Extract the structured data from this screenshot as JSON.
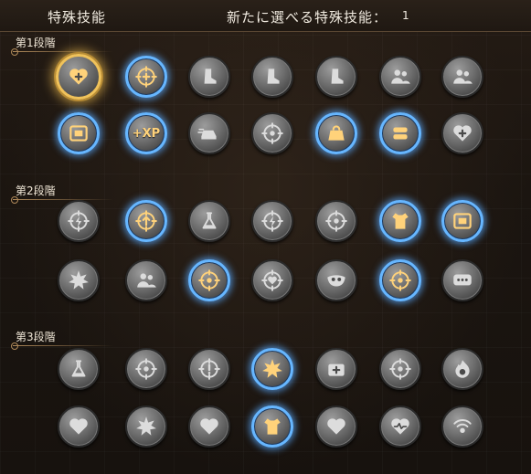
{
  "header": {
    "title": "特殊技能",
    "new_selectable": "新たに選べる特殊技能：",
    "count": "1"
  },
  "stages": [
    {
      "label": "第1段階",
      "rows": [
        [
          {
            "icon": "heart-plus-icon",
            "state": "selected"
          },
          {
            "icon": "crosshair-plus-icon",
            "state": "active"
          },
          {
            "icon": "boot-stripes-icon",
            "state": "inactive"
          },
          {
            "icon": "boot-icon",
            "state": "inactive"
          },
          {
            "icon": "running-shoe-icon",
            "state": "inactive"
          },
          {
            "icon": "team-star-icon",
            "state": "inactive"
          },
          {
            "icon": "squad-alert-icon",
            "state": "inactive"
          }
        ],
        [
          {
            "icon": "ticket-icon",
            "state": "active"
          },
          {
            "icon": "xp-plus-icon",
            "state": "active",
            "text": "+XP"
          },
          {
            "icon": "speed-car-icon",
            "state": "inactive"
          },
          {
            "icon": "target-timer-icon",
            "state": "inactive"
          },
          {
            "icon": "weight-icon",
            "state": "active"
          },
          {
            "icon": "ammo-icon",
            "state": "active"
          },
          {
            "icon": "heart-plus-medkit-icon",
            "state": "inactive"
          }
        ]
      ]
    },
    {
      "label": "第2段階",
      "rows": [
        [
          {
            "icon": "lightning-target-icon",
            "state": "inactive"
          },
          {
            "icon": "crosshair-arrow-icon",
            "state": "active"
          },
          {
            "icon": "flask-icon",
            "state": "inactive"
          },
          {
            "icon": "lightning-target-icon",
            "state": "inactive"
          },
          {
            "icon": "blast-target-icon",
            "state": "inactive"
          },
          {
            "icon": "armor-vest-icon",
            "state": "active"
          },
          {
            "icon": "cards-icon",
            "state": "active"
          }
        ],
        [
          {
            "icon": "burst-arrows-icon",
            "state": "inactive"
          },
          {
            "icon": "team-refresh-icon",
            "state": "inactive"
          },
          {
            "icon": "cycle-target-icon",
            "state": "active"
          },
          {
            "icon": "heart-target-icon",
            "state": "inactive"
          },
          {
            "icon": "mask-icon",
            "state": "inactive"
          },
          {
            "icon": "drop-target-icon",
            "state": "active"
          },
          {
            "icon": "chat-bubble-icon",
            "state": "inactive"
          }
        ]
      ]
    },
    {
      "label": "第3段階",
      "rows": [
        [
          {
            "icon": "flask-up-icon",
            "state": "inactive"
          },
          {
            "icon": "runner-target-icon",
            "state": "inactive"
          },
          {
            "icon": "alert-target-icon",
            "state": "inactive"
          },
          {
            "icon": "burst-hand-icon",
            "state": "active"
          },
          {
            "icon": "medkit-arrow-icon",
            "state": "inactive"
          },
          {
            "icon": "boot-target-icon",
            "state": "inactive"
          },
          {
            "icon": "fire-skull-icon",
            "state": "inactive"
          }
        ],
        [
          {
            "icon": "heart-icon",
            "state": "inactive"
          },
          {
            "icon": "explosion-icon",
            "state": "inactive"
          },
          {
            "icon": "heart-shield-icon",
            "state": "inactive"
          },
          {
            "icon": "armor-up-icon",
            "state": "active"
          },
          {
            "icon": "bleed-heart-icon",
            "state": "inactive"
          },
          {
            "icon": "heart-pulse-icon",
            "state": "inactive"
          },
          {
            "icon": "wifi-runner-icon",
            "state": "inactive"
          }
        ]
      ]
    }
  ],
  "colors": {
    "active_ring": "#66b6ff",
    "selected_ring": "#f0c25a",
    "icon_active": "#ffd27a",
    "icon_inactive": "#dcdcdc"
  }
}
